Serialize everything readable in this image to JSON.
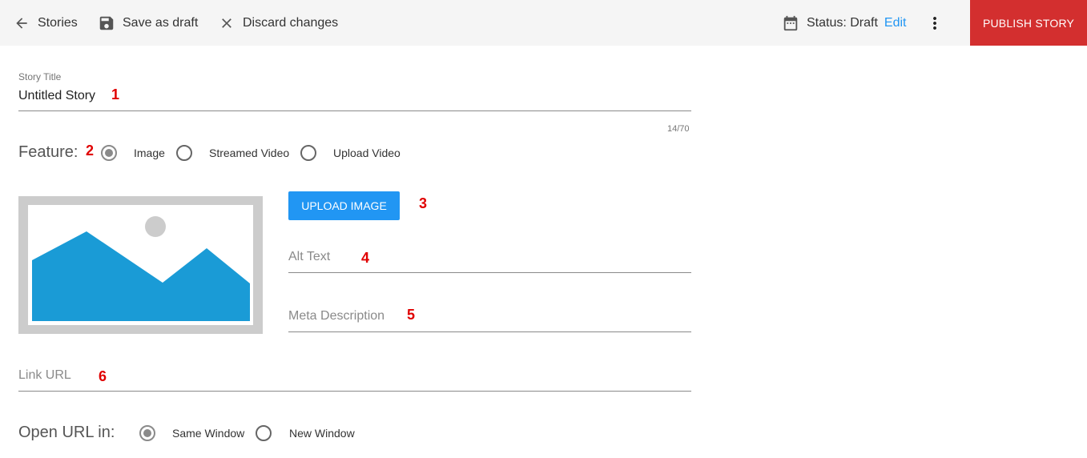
{
  "toolbar": {
    "back_label": "Stories",
    "save_label": "Save as draft",
    "discard_label": "Discard changes",
    "status_label": "Status: Draft",
    "edit_label": "Edit",
    "publish_label": "PUBLISH STORY"
  },
  "form": {
    "title": {
      "label": "Story Title",
      "value": "Untitled Story",
      "counter": "14/70",
      "marker": "1"
    },
    "feature": {
      "label": "Feature:",
      "marker": "2",
      "options": [
        "Image",
        "Streamed Video",
        "Upload Video"
      ],
      "selected": "Image"
    },
    "upload": {
      "label": "UPLOAD IMAGE",
      "marker": "3"
    },
    "alt_text": {
      "placeholder": "Alt Text",
      "marker": "4"
    },
    "meta_description": {
      "placeholder": "Meta Description",
      "marker": "5"
    },
    "link_url": {
      "placeholder": "Link URL",
      "marker": "6"
    },
    "open_url": {
      "label": "Open URL in:",
      "options": [
        "Same Window",
        "New Window"
      ],
      "selected": "Same Window"
    }
  },
  "colors": {
    "publish": "#d32f2f",
    "upload": "#2196f3",
    "edit_link": "#2196f3",
    "image_sky": "#ffffff",
    "image_mountain": "#1a9bd6",
    "image_frame": "#cccccc"
  },
  "icons": [
    "arrow-left-icon",
    "floppy-disk-icon",
    "close-icon",
    "calendar-icon",
    "more-vertical-icon",
    "image-placeholder-icon"
  ]
}
